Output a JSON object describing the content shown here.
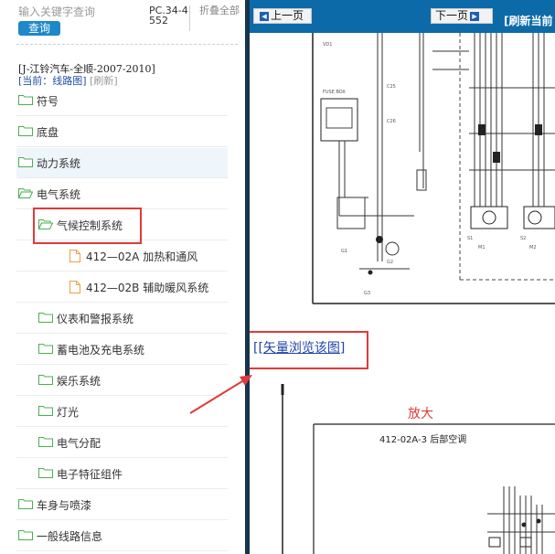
{
  "search": {
    "placeholder": "输入关键字查询",
    "button_label": "查询"
  },
  "header": {
    "pc_code": "PC.34-4552",
    "collapse_all": "折叠全部"
  },
  "vehicle": "[J-江铃汽车-全顺-2007-2010]",
  "breadcrumb": {
    "bracket_open": "[",
    "current": "当前：线路图",
    "bracket_close": "]",
    "refresh": "[刷新]"
  },
  "tree": [
    {
      "label": "符号"
    },
    {
      "label": "底盘"
    },
    {
      "label": "动力系统"
    },
    {
      "label": "电气系统"
    },
    {
      "label": "气候控制系统"
    },
    {
      "label": "412—02A 加热和通风"
    },
    {
      "label": "412—02B 辅助暖风系统"
    },
    {
      "label": "仪表和警报系统"
    },
    {
      "label": "蓄电池及充电系统"
    },
    {
      "label": "娱乐系统"
    },
    {
      "label": "灯光"
    },
    {
      "label": "电气分配"
    },
    {
      "label": "电子特征组件"
    },
    {
      "label": "车身与喷漆"
    },
    {
      "label": "一般线路信息"
    }
  ],
  "toolbar": {
    "prev_label": "上一页",
    "next_label": "下一页",
    "refresh_label": "[刷新当前"
  },
  "vector_link": {
    "open": "[",
    "label": "[矢量浏览该图]"
  },
  "annotation": {
    "zoom_label": "放大"
  },
  "diagram": {
    "page_label": "412-02A-3 后部空调",
    "small_labels": [
      "VD1",
      "FUSE BOX",
      "C25",
      "C26",
      "G1",
      "G2",
      "G3",
      "S1",
      "S2",
      "M1",
      "M2"
    ]
  },
  "colors": {
    "toolbar": "#0d6aa8",
    "divider": "#17344d",
    "query_button": "#1e88c8",
    "highlight": "#e03a3a",
    "link": "#2244aa"
  }
}
